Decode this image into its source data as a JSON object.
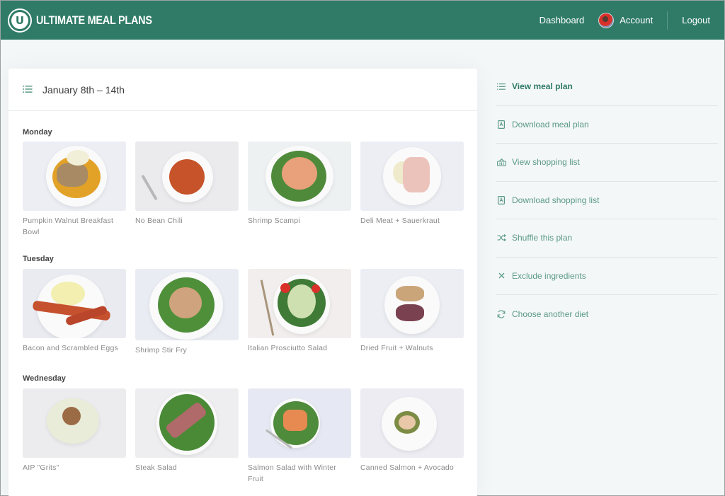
{
  "brand": {
    "name": "ULTIMATE MEAL PLANS",
    "logo_letter": "U"
  },
  "nav": {
    "dashboard": "Dashboard",
    "account": "Account",
    "logout": "Logout"
  },
  "plan": {
    "title": "January 8th – 14th",
    "days": [
      {
        "name": "Monday",
        "meals": [
          {
            "name": "Pumpkin Walnut Breakfast Bowl"
          },
          {
            "name": "No Bean Chili"
          },
          {
            "name": "Shrimp Scampi"
          },
          {
            "name": "Deli Meat + Sauerkraut"
          }
        ]
      },
      {
        "name": "Tuesday",
        "meals": [
          {
            "name": "Bacon and Scrambled Eggs"
          },
          {
            "name": "Shrimp Stir Fry"
          },
          {
            "name": "Italian Prosciutto Salad"
          },
          {
            "name": "Dried Fruit + Walnuts"
          }
        ]
      },
      {
        "name": "Wednesday",
        "meals": [
          {
            "name": "AIP \"Grits\""
          },
          {
            "name": "Steak Salad"
          },
          {
            "name": "Salmon Salad with Winter Fruit"
          },
          {
            "name": "Canned Salmon + Avocado"
          }
        ]
      }
    ]
  },
  "sidebar": {
    "items": [
      {
        "label": "View meal plan",
        "icon": "list-icon"
      },
      {
        "label": "Download meal plan",
        "icon": "pdf-icon"
      },
      {
        "label": "View shopping list",
        "icon": "basket-icon"
      },
      {
        "label": "Download shopping list",
        "icon": "pdf-icon"
      },
      {
        "label": "Shuffle this plan",
        "icon": "shuffle-icon"
      },
      {
        "label": "Exclude ingredients",
        "icon": "close-icon"
      },
      {
        "label": "Choose another diet",
        "icon": "refresh-icon"
      }
    ]
  },
  "colors": {
    "brand": "#2f7b67",
    "accent": "#5a9a86"
  }
}
